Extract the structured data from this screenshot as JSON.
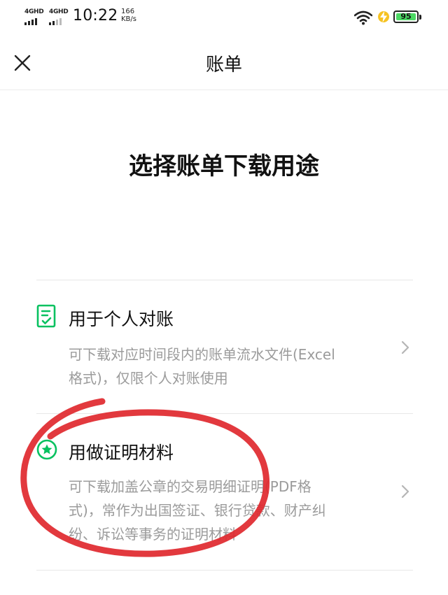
{
  "status_bar": {
    "sim1_label": "4GHD",
    "sim2_label": "4GHD",
    "time": "10:22",
    "speed_value": "166",
    "speed_unit": "KB/s",
    "battery_level": "95",
    "battery_color": "#4cd964"
  },
  "nav": {
    "title": "账单",
    "close_icon": "close-icon"
  },
  "heading": "选择账单下载用途",
  "options": [
    {
      "icon": "document-check-icon",
      "title": "用于个人对账",
      "desc_line1": "可下载对应时间段内的账单流水文件(Excel",
      "desc_line2": "格式)，仅限个人对账使用"
    },
    {
      "icon": "star-badge-icon",
      "title": "用做证明材料",
      "desc_line1": "可下载加盖公章的交易明细证明(PDF格",
      "desc_line2": "式)，常作为出国签证、银行贷款、财产纠",
      "desc_line3": "纷、诉讼等事务的证明材料"
    }
  ],
  "colors": {
    "accent_green": "#07c160",
    "annotation_red": "#e0282e"
  }
}
